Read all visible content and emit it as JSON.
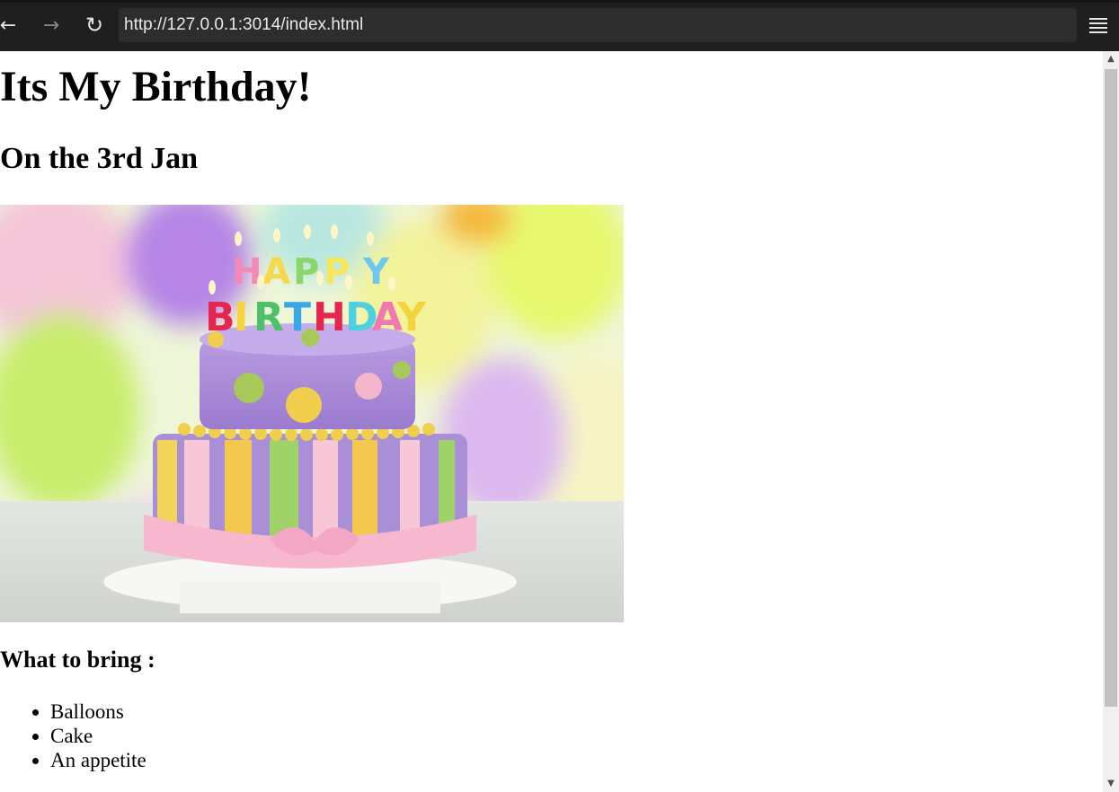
{
  "browser": {
    "url": "http://127.0.0.1:3014/index.html",
    "icons": {
      "back": "arrow-left-icon",
      "forward": "arrow-right-icon",
      "reload": "reload-icon",
      "menu": "hamburger-menu-icon"
    }
  },
  "page": {
    "title": "Its My Birthday!",
    "subtitle": "On the 3rd Jan",
    "image": {
      "alt": "birthday cake"
    },
    "list_heading": "What to bring :",
    "list_items": [
      "Balloons",
      "Cake",
      "An appetite"
    ]
  },
  "colors": {
    "toolbar_bg": "#1f1f1f",
    "urlbar_bg": "#2d2d2d",
    "scroll_thumb": "#c1c1c1"
  }
}
